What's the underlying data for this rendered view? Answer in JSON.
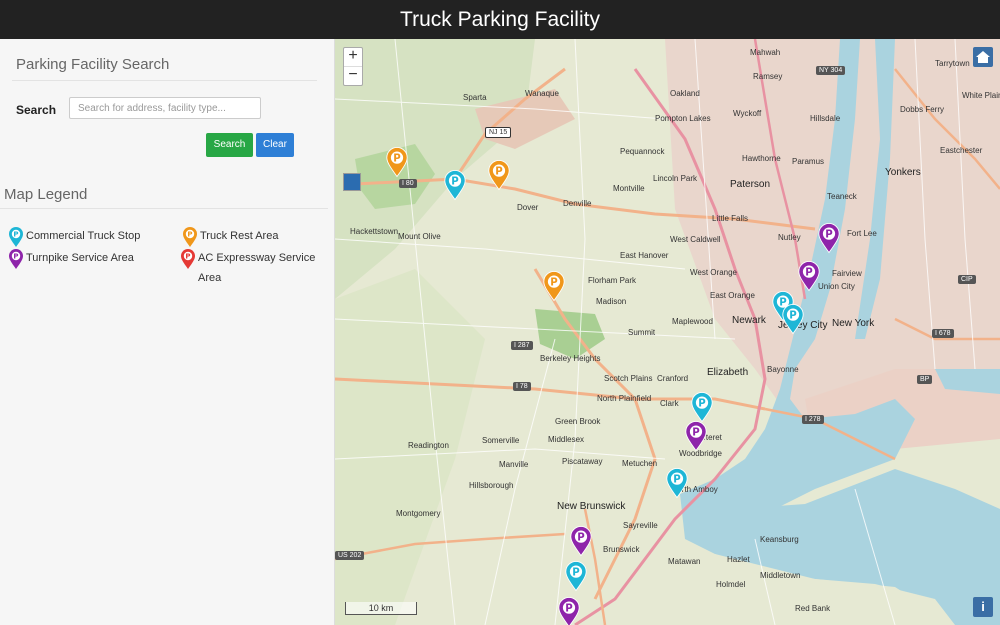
{
  "header": {
    "title": "Truck Parking Facility"
  },
  "sidebar": {
    "search_section_title": "Parking Facility Search",
    "search_label": "Search",
    "search_placeholder": "Search for address, facility type...",
    "search_value": "",
    "search_button": "Search",
    "clear_button": "Clear",
    "legend_title": "Map Legend",
    "legend": [
      {
        "label": "Commercial Truck Stop",
        "color": "#1eb6d6"
      },
      {
        "label": "Truck Rest Area",
        "color": "#f0971a"
      },
      {
        "label": "Turnpike Service Area",
        "color": "#8e24aa"
      },
      {
        "label": "AC Expressway Service Area",
        "color": "#e53935"
      }
    ]
  },
  "map": {
    "zoom_in": "+",
    "zoom_out": "−",
    "scale_label": "10 km",
    "info_label": "i",
    "places": [
      "Mahwah",
      "Ramsey",
      "Wanaque",
      "Sparta",
      "Oakland",
      "Wyckoff",
      "Hillsdale",
      "Tarrytown",
      "Dobbs Ferry",
      "White Plains",
      "Pompton Lakes",
      "Pequannock",
      "Hawthorne",
      "Paramus",
      "Yonkers",
      "Eastchester",
      "Lincoln Park",
      "Paterson",
      "Teaneck",
      "Montville",
      "Little Falls",
      "Fort Lee",
      "Dover",
      "Denville",
      "Mount Olive",
      "Hackettstown",
      "West Caldwell",
      "Nutley",
      "East Hanover",
      "Fairview",
      "West Orange",
      "Union City",
      "Florham Park",
      "East Orange",
      "Newark",
      "Madison",
      "Jersey City",
      "New York",
      "Summit",
      "Maplewood",
      "Berkeley Heights",
      "Bayonne",
      "Elizabeth",
      "Scotch Plains",
      "Cranford",
      "North Plainfield",
      "Clark",
      "Green Brook",
      "Woodbridge",
      "Middlesex",
      "Readington",
      "Somerville",
      "Piscataway",
      "Metuchen",
      "Carteret",
      "Manville",
      "Perth Amboy",
      "New Brunswick",
      "Montgomery",
      "Hillsborough",
      "Sayreville",
      "Keansburg",
      "Hazlet",
      "Matawan",
      "Middletown",
      "Holmdel",
      "Red Bank",
      "Brunswick",
      "Mount Olive"
    ],
    "shields": [
      "NY 304",
      "NJ 15",
      "I 80",
      "I 287",
      "I 78",
      "I 278",
      "I 678",
      "US 202",
      "CIP",
      "BP"
    ],
    "pins": [
      {
        "type": "Truck Rest Area",
        "color": "#f0971a"
      },
      {
        "type": "Commercial Truck Stop",
        "color": "#1eb6d6"
      },
      {
        "type": "Truck Rest Area",
        "color": "#f0971a"
      },
      {
        "type": "Truck Rest Area",
        "color": "#f0971a"
      },
      {
        "type": "Turnpike Service Area",
        "color": "#8e24aa"
      },
      {
        "type": "Turnpike Service Area",
        "color": "#8e24aa"
      },
      {
        "type": "Commercial Truck Stop",
        "color": "#1eb6d6"
      },
      {
        "type": "Commercial Truck Stop",
        "color": "#1eb6d6"
      },
      {
        "type": "Turnpike Service Area",
        "color": "#8e24aa"
      },
      {
        "type": "Commercial Truck Stop",
        "color": "#1eb6d6"
      },
      {
        "type": "Turnpike Service Area",
        "color": "#8e24aa"
      },
      {
        "type": "Commercial Truck Stop",
        "color": "#1eb6d6"
      },
      {
        "type": "Turnpike Service Area",
        "color": "#8e24aa"
      },
      {
        "type": "Commercial Truck Stop",
        "color": "#1eb6d6"
      }
    ]
  }
}
